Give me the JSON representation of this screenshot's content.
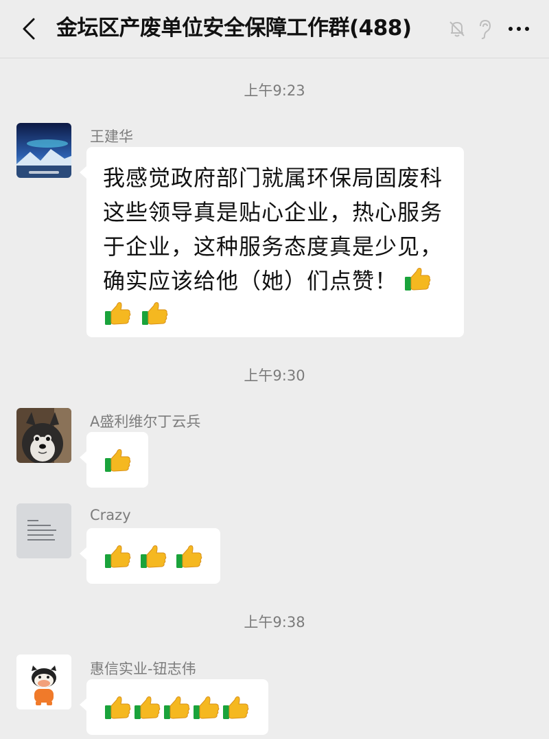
{
  "header": {
    "title": "金坛区产废单位安全保障工作群(488)"
  },
  "timestamps": [
    "上午9:23",
    "上午9:30",
    "上午9:38"
  ],
  "messages": [
    {
      "sender": "王建华",
      "text": "我感觉政府部门就属环保局固废科这些领导真是贴心企业，热心服务于企业，这种服务态度真是少见，确实应该给他（她）们点赞！",
      "emoji": "thumbs-up",
      "emoji_count": 3
    },
    {
      "sender": "A盛利维尔丁云兵",
      "emoji": "thumbs-up",
      "emoji_count": 1
    },
    {
      "sender": "Crazy",
      "emoji": "thumbs-up",
      "emoji_count": 3
    },
    {
      "sender": "惠信实业-钮志伟",
      "emoji": "thumbs-up",
      "emoji_count": 5
    }
  ],
  "colors": {
    "background": "#ededed",
    "bubble": "#ffffff",
    "timestamp": "#7b7b7b",
    "sender": "#7c7c7c"
  }
}
